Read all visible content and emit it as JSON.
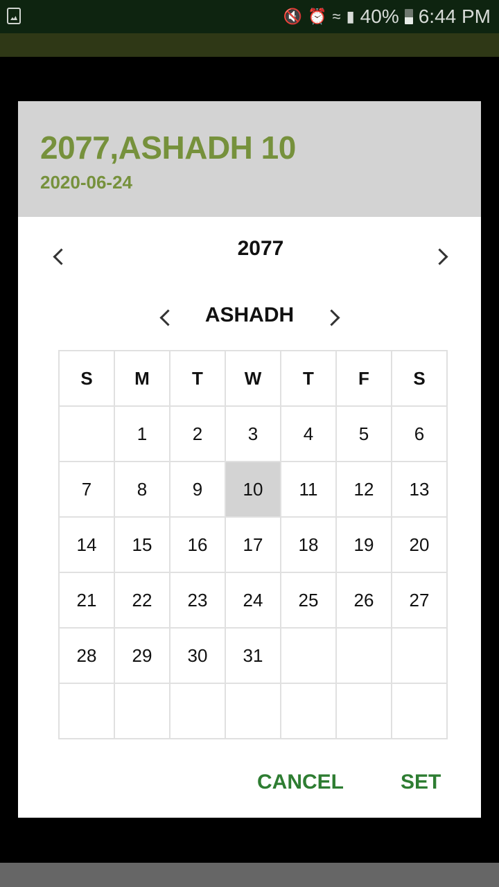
{
  "status_bar": {
    "battery_percent": "40%",
    "time": "6:44 PM",
    "icons": [
      "gallery-icon",
      "mute-icon",
      "alarm-icon",
      "wifi-icon",
      "signal-icon",
      "battery-icon"
    ]
  },
  "dialog": {
    "title": "2077,ASHADH 10",
    "subtitle": "2020-06-24",
    "year": "2077",
    "month": "ASHADH",
    "weekdays": [
      "S",
      "M",
      "T",
      "W",
      "T",
      "F",
      "S"
    ],
    "days": [
      "",
      "1",
      "2",
      "3",
      "4",
      "5",
      "6",
      "7",
      "8",
      "9",
      "10",
      "11",
      "12",
      "13",
      "14",
      "15",
      "16",
      "17",
      "18",
      "19",
      "20",
      "21",
      "22",
      "23",
      "24",
      "25",
      "26",
      "27",
      "28",
      "29",
      "30",
      "31",
      "",
      "",
      "",
      "",
      "",
      "",
      "",
      "",
      "",
      ""
    ],
    "selected_day": "10",
    "cancel_label": "CANCEL",
    "set_label": "SET"
  },
  "colors": {
    "accent": "#76913c",
    "button": "#2e7d32",
    "selected_bg": "#d3d3d3"
  }
}
